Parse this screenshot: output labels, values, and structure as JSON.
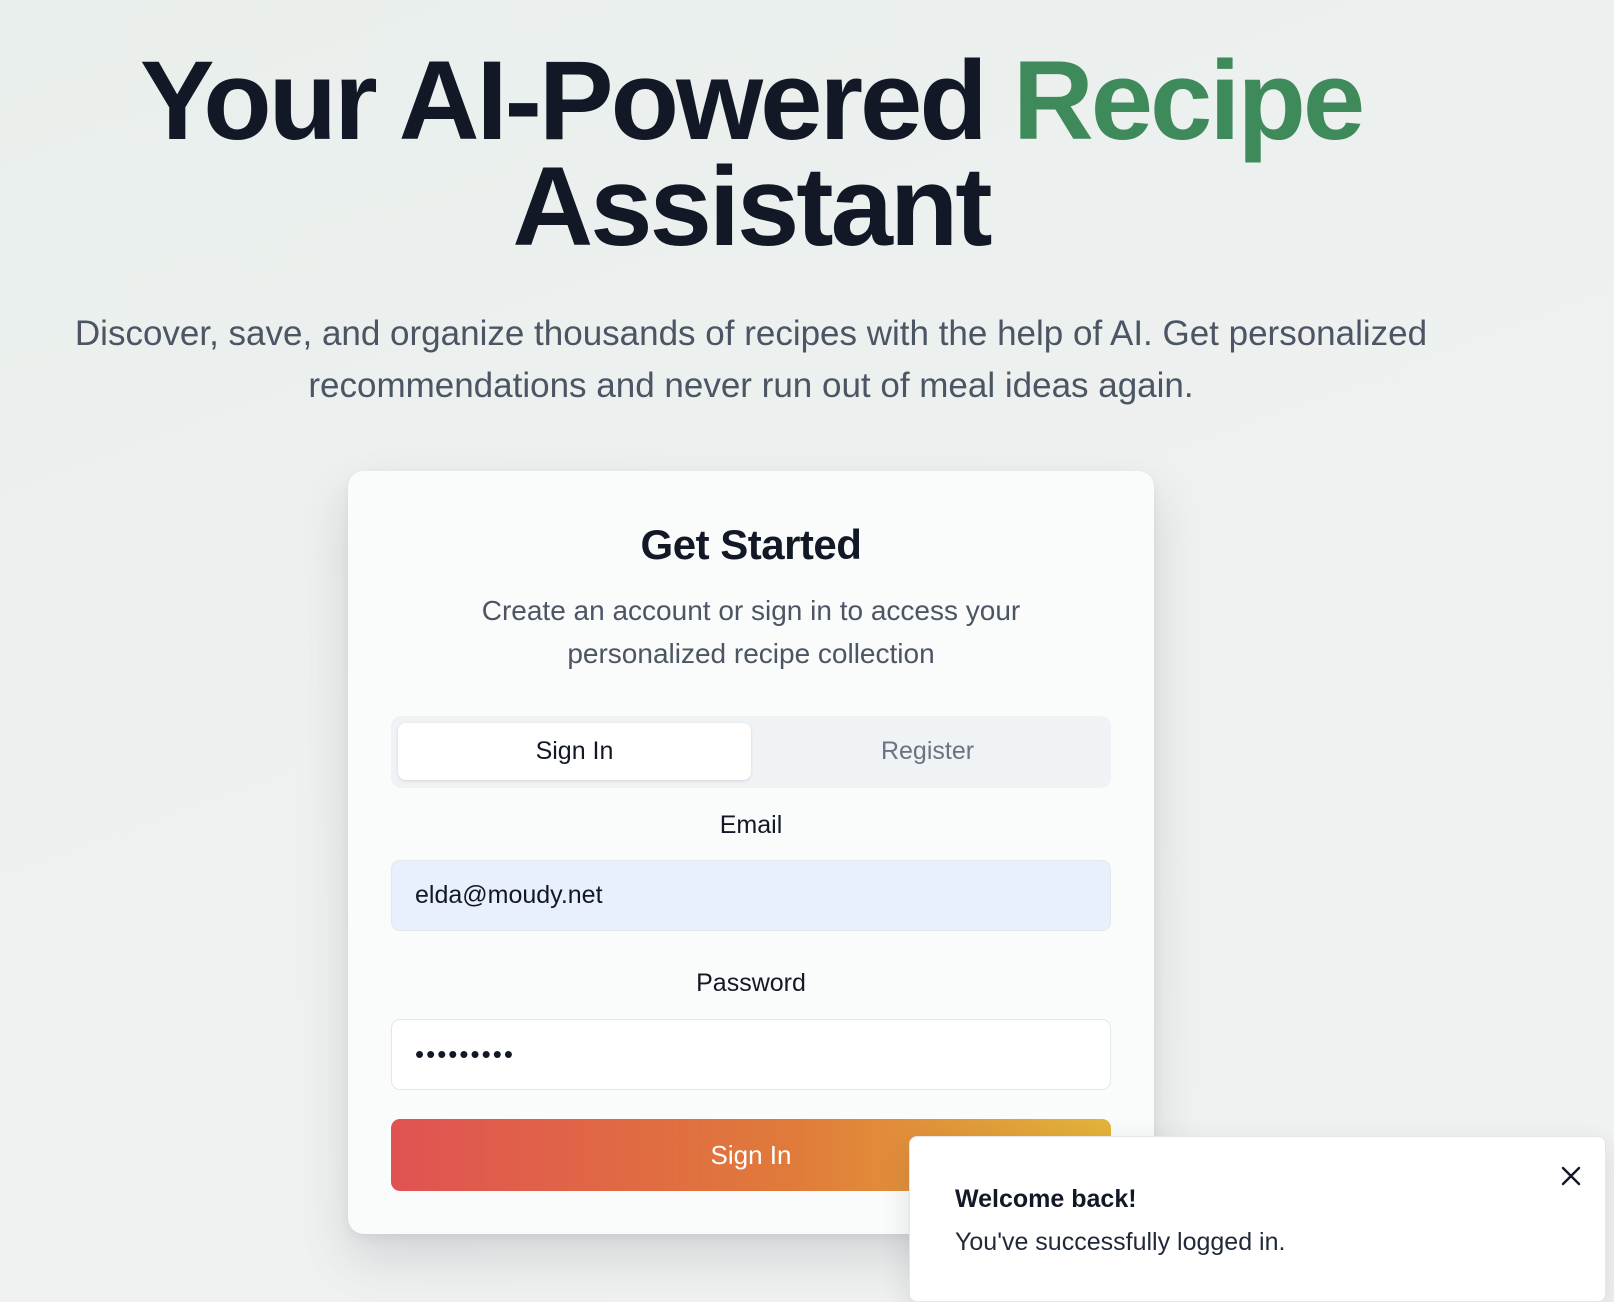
{
  "hero": {
    "title_part1": "Your AI-Powered ",
    "title_accent": "Recipe",
    "title_part2": "Assistant",
    "subtitle": "Discover, save, and organize thousands of recipes with the help of AI. Get personalized recommendations and never run out of meal ideas again."
  },
  "auth_card": {
    "title": "Get Started",
    "description": "Create an account or sign in to access your personalized recipe collection",
    "tabs": [
      {
        "label": "Sign In",
        "active": true
      },
      {
        "label": "Register",
        "active": false
      }
    ],
    "email_label": "Email",
    "email_value": "elda@moudy.net",
    "password_label": "Password",
    "password_masked": "•••••••••",
    "submit_label": "Sign In"
  },
  "toast": {
    "title": "Welcome back!",
    "message": "You've successfully logged in.",
    "close_icon": "close-icon"
  },
  "colors": {
    "accent_green": "#3f8a5b",
    "heading": "#121826",
    "button_gradient_start": "#e05252",
    "button_gradient_end": "#e3b43a",
    "email_input_bg": "#e8effd"
  }
}
